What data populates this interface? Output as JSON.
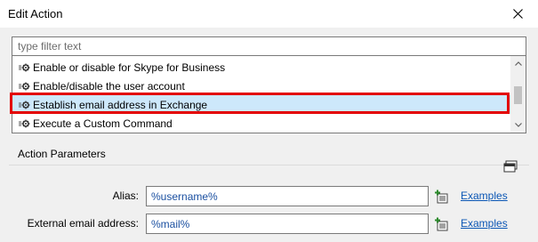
{
  "window": {
    "title": "Edit Action"
  },
  "filter": {
    "placeholder": "type filter text"
  },
  "actions": [
    {
      "label": "Enable or disable for Skype for Business"
    },
    {
      "label": "Enable/disable the user account"
    },
    {
      "label": "Establish email address in Exchange",
      "selected": true
    },
    {
      "label": "Execute a Custom Command"
    }
  ],
  "parameters": {
    "title": "Action Parameters",
    "fields": [
      {
        "label": "Alias:",
        "value": "%username%",
        "link": "Examples"
      },
      {
        "label": "External email address:",
        "value": "%mail%",
        "link": "Examples"
      }
    ]
  },
  "colors": {
    "selection": "#cde8fb",
    "highlight_border": "#e30000",
    "link": "#0b57b5",
    "variable_text": "#1a4fa0",
    "insert_icon": "#2e8b2e"
  },
  "icons": {
    "action_item": "gear-list-icon",
    "close": "close-icon",
    "insert": "insert-variable-icon",
    "params_toggle": "panel-toggle-icon"
  }
}
